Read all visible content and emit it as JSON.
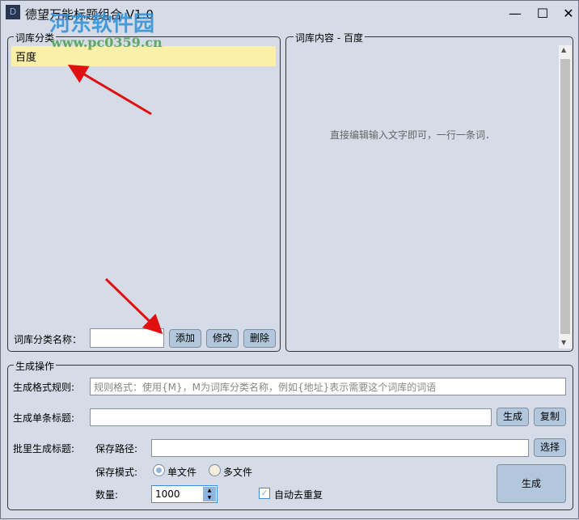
{
  "window": {
    "title": "德望万能标题组合 V1.0",
    "minimize": "—",
    "maximize": "☐",
    "close": "✕"
  },
  "watermark": {
    "name": "河东软件园",
    "url": "www.pc0359.cn"
  },
  "left": {
    "group_label": "词库分类",
    "items": [
      "百度"
    ],
    "name_label": "词库分类名称：",
    "name_value": "",
    "add": "添加",
    "edit": "修改",
    "delete": "删除"
  },
  "right": {
    "group_label": "词库内容 - 百度",
    "hint": "直接编辑输入文字即可，一行一条词．"
  },
  "gen": {
    "group_label": "生成操作",
    "rule_label": "生成格式规则:",
    "rule_placeholder": "规则格式：使用{M}，M为词库分类名称，例如{地址}表示需要这个词库的词语",
    "single_label": "生成单条标题:",
    "single_value": "",
    "single_generate": "生成",
    "copy": "复制",
    "batch_label": "批里生成标题:",
    "path_label": "保存路径:",
    "path_value": "",
    "choose": "选择",
    "mode_label": "保存模式:",
    "mode_single": "单文件",
    "mode_multi": "多文件",
    "mode_selected": "single",
    "count_label": "数量:",
    "count_value": "1000",
    "dedupe_label": "自动去重复",
    "dedupe_checked": true,
    "batch_generate": "生成"
  }
}
